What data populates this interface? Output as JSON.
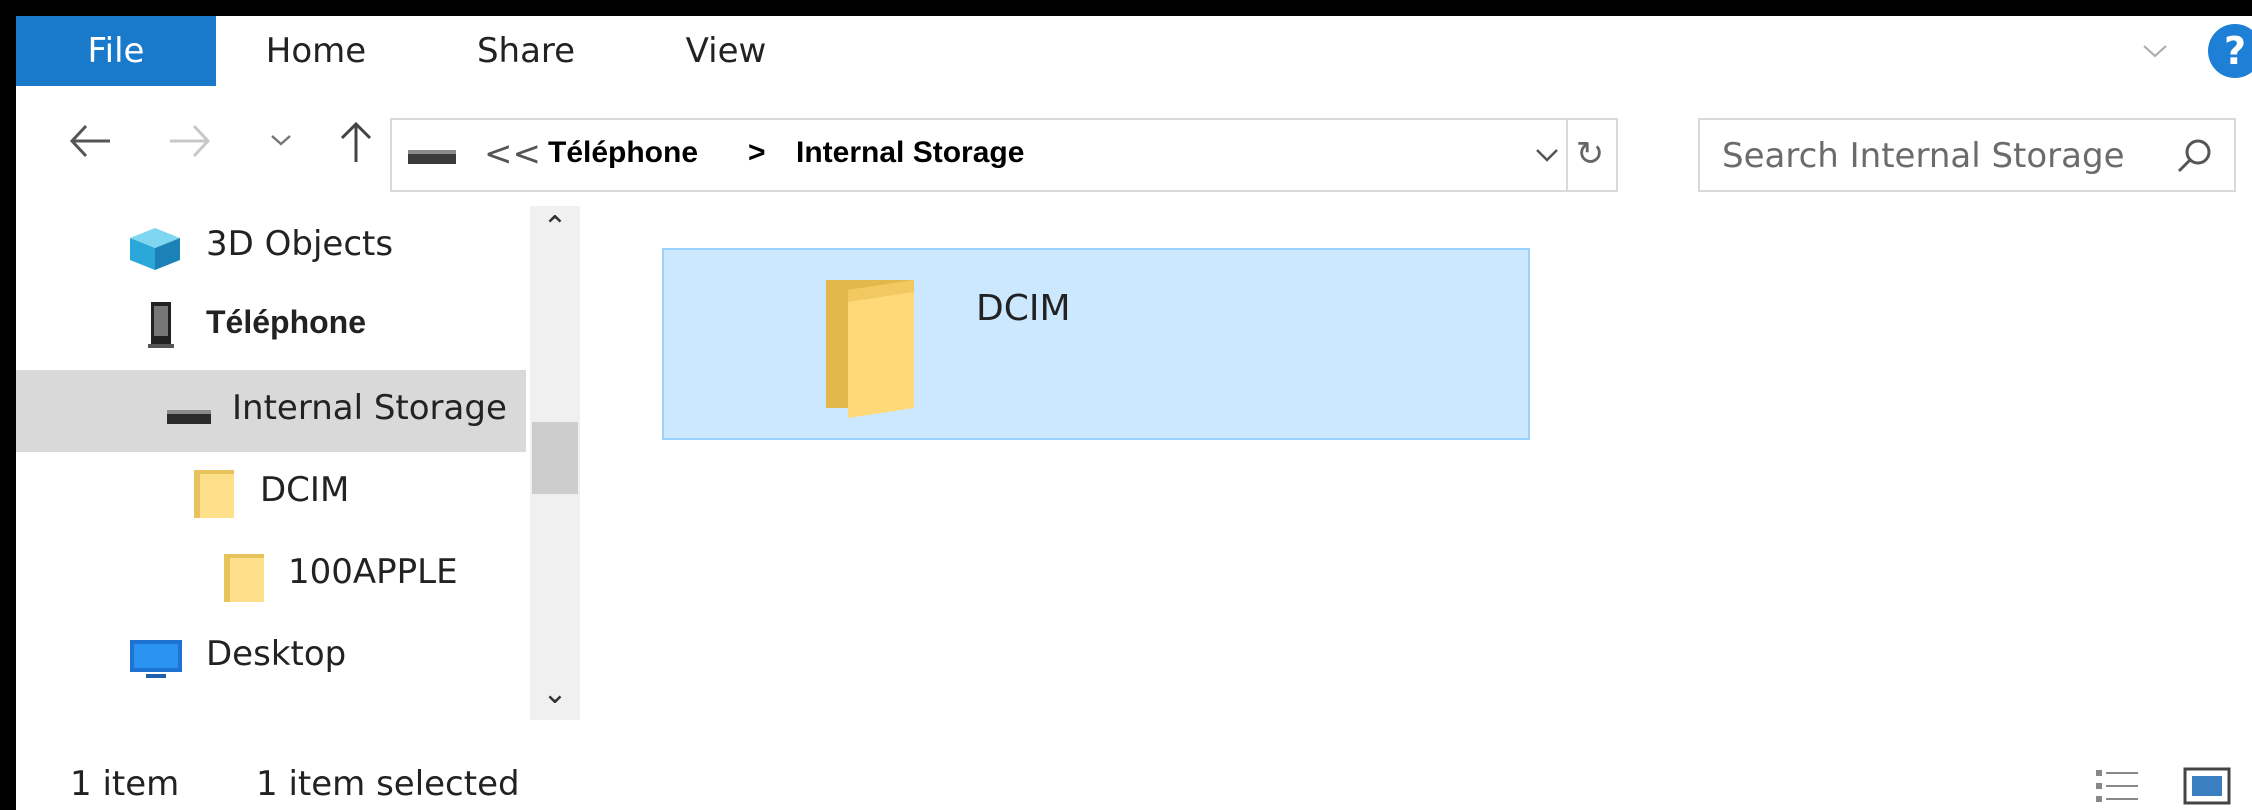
{
  "ribbon": {
    "tabs": [
      {
        "label": "File",
        "active": true
      },
      {
        "label": "Home"
      },
      {
        "label": "Share"
      },
      {
        "label": "View"
      }
    ],
    "help_label": "?"
  },
  "navigation": {
    "back_icon": "arrow-left-icon",
    "forward_icon": "arrow-right-icon",
    "recent_icon": "chevron-down-icon",
    "up_icon": "arrow-up-icon"
  },
  "address_bar": {
    "overflow_marker": "<<",
    "breadcrumb": [
      "Téléphone",
      "Internal Storage"
    ],
    "separator": ">"
  },
  "search": {
    "placeholder": "Search Internal Storage"
  },
  "sidebar": {
    "items": [
      {
        "label": "3D Objects",
        "icon": "3d-cube-icon"
      },
      {
        "label": "Téléphone",
        "icon": "phone-icon"
      },
      {
        "label": "Internal Storage",
        "icon": "drive-icon",
        "selected": true
      },
      {
        "label": "DCIM",
        "icon": "folder-icon"
      },
      {
        "label": "100APPLE",
        "icon": "folder-icon"
      },
      {
        "label": "Desktop",
        "icon": "desktop-icon"
      }
    ]
  },
  "content": {
    "items": [
      {
        "name": "DCIM",
        "icon": "folder-icon",
        "selected": true
      }
    ]
  },
  "status_bar": {
    "item_count": "1 item",
    "selection": "1 item selected"
  },
  "colors": {
    "file_tab": "#1979ca",
    "selection_fill": "#cce8ff",
    "selection_border": "#99d1ff",
    "sidebar_selected": "#d9d9d9"
  }
}
